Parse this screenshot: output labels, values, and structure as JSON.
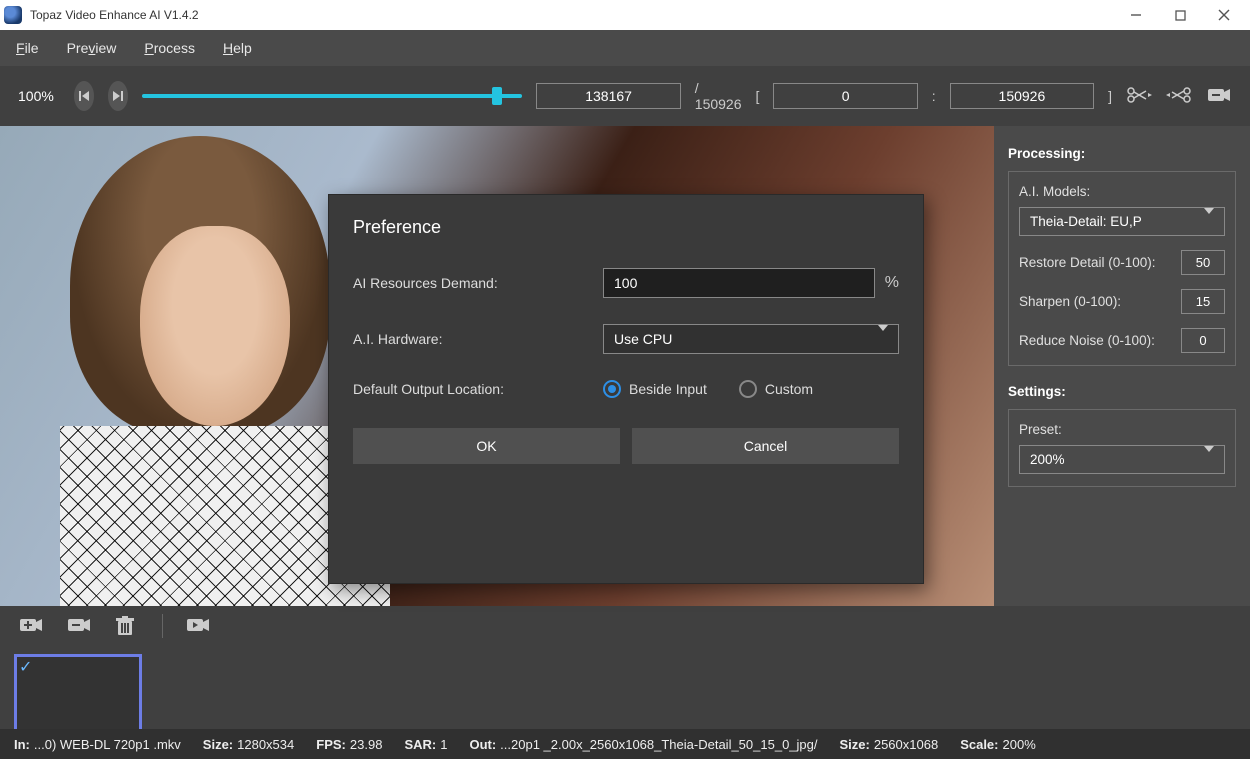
{
  "title_bar": {
    "title": "Topaz Video Enhance AI V1.4.2"
  },
  "menu": {
    "file": "File",
    "preview": "Preview",
    "process": "Process",
    "help": "Help"
  },
  "toolbar": {
    "zoom": "100%",
    "current_frame": "138167",
    "total_frames": "/ 150926",
    "range_start": "0",
    "range_end": "150926"
  },
  "processing": {
    "title": "Processing:",
    "models_label": "A.I. Models:",
    "model_selected": "Theia-Detail: EU,P",
    "restore_label": "Restore Detail (0-100):",
    "restore_value": "50",
    "sharpen_label": "Sharpen (0-100):",
    "sharpen_value": "15",
    "noise_label": "Reduce Noise (0-100):",
    "noise_value": "0"
  },
  "settings": {
    "title": "Settings:",
    "preset_label": "Preset:",
    "preset_value": "200%"
  },
  "dialog": {
    "title": "Preference",
    "resources_label": "AI Resources Demand:",
    "resources_value": "100",
    "resources_suffix": "%",
    "hardware_label": "A.I. Hardware:",
    "hardware_value": "Use CPU",
    "output_label": "Default Output Location:",
    "opt_beside": "Beside Input",
    "opt_custom": "Custom",
    "ok": "OK",
    "cancel": "Cancel"
  },
  "status": {
    "in_label": "In:",
    "in_value": "...0) WEB-DL  720p1 .mkv",
    "size1_label": "Size:",
    "size1_value": "1280x534",
    "fps_label": "FPS:",
    "fps_value": "23.98",
    "sar_label": "SAR:",
    "sar_value": "1",
    "out_label": "Out:",
    "out_value": "...20p1 _2.00x_2560x1068_Theia-Detail_50_15_0_jpg/",
    "size2_label": "Size:",
    "size2_value": "2560x1068",
    "scale_label": "Scale:",
    "scale_value": "200%"
  }
}
